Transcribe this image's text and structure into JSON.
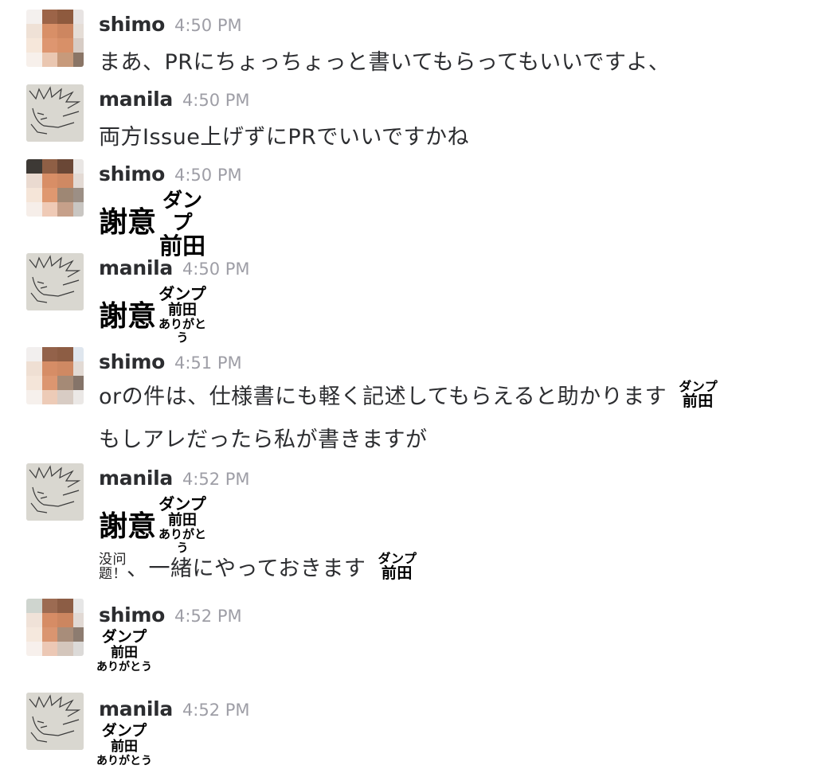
{
  "messages": [
    {
      "user": "shimo",
      "time": "4:50 PM",
      "text": "まあ、PRにちょっちょっと書いてもらってもいいですよ、"
    },
    {
      "user": "manila",
      "time": "4:50 PM",
      "text": "両方Issue上げずにPRでいいですかね"
    },
    {
      "user": "shimo",
      "time": "4:50 PM",
      "sticker": {
        "main": "謝意",
        "top": "ダンプ",
        "mid": "前田"
      }
    },
    {
      "user": "manila",
      "time": "4:50 PM",
      "sticker": {
        "main": "謝意",
        "top": "ダンプ",
        "mid": "前田",
        "bottom": "ありがとう"
      }
    },
    {
      "user": "shimo",
      "time": "4:51 PM",
      "text": "orの件は、仕様書にも軽く記述してもらえると助かります",
      "emoji": {
        "top": "ダンプ",
        "mid": "前田"
      },
      "text2": "もしアレだったら私が書きますが"
    },
    {
      "user": "manila",
      "time": "4:52 PM",
      "sticker": {
        "main": "謝意",
        "top": "ダンプ",
        "mid": "前田",
        "bottom": "ありがとう"
      },
      "emoji_text": {
        "top": "没问",
        "bottom": "题！"
      },
      "text": "、一緒にやっておきます",
      "emoji": {
        "top": "ダンプ",
        "mid": "前田"
      }
    },
    {
      "user": "shimo",
      "time": "4:52 PM",
      "sticker": {
        "top": "ダンプ",
        "mid": "前田",
        "bottom": "ありがとう"
      }
    },
    {
      "user": "manila",
      "time": "4:52 PM",
      "sticker": {
        "top": "ダンプ",
        "mid": "前田",
        "bottom": "ありがとう"
      }
    }
  ],
  "colors": {
    "name": "#2c2d30",
    "time": "#9e9ea6",
    "text": "#2c2d30"
  }
}
